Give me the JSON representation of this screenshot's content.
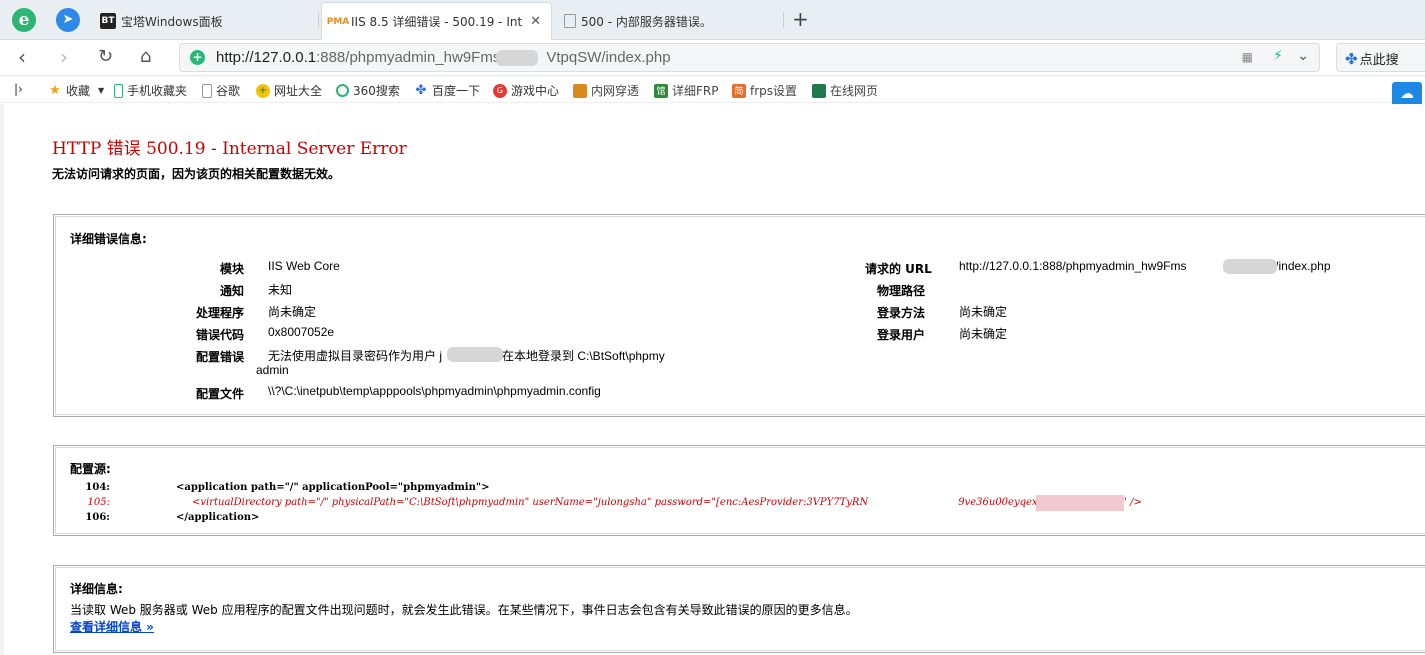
{
  "tabs": [
    {
      "label": "宝塔Windows面板",
      "favicon": "BT"
    },
    {
      "label": "IIS 8.5 详细错误 - 500.19 - Inte",
      "favicon": "PMA"
    },
    {
      "label": "500 - 内部服务器错误。",
      "favicon": ""
    }
  ],
  "address": {
    "url_prefix": "http://127.0.0.1",
    "url_suffix": ":888/phpmyadmin_hw9Fms",
    "url_tail": "VtpqSW/index.php"
  },
  "search": {
    "label": "点此搜"
  },
  "bookmarks": [
    {
      "label": "收藏",
      "icon": "star-icon"
    },
    {
      "label": "手机收藏夹",
      "icon": "phone-icon"
    },
    {
      "label": "谷歌",
      "icon": "page-icon"
    },
    {
      "label": "网址大全",
      "icon": "web-icon"
    },
    {
      "label": "360搜索",
      "icon": "360-icon"
    },
    {
      "label": "百度一下",
      "icon": "baidu-icon"
    },
    {
      "label": "游戏中心",
      "icon": "game-icon"
    },
    {
      "label": "内网穿透",
      "icon": "app-icon"
    },
    {
      "label": "详细FRP",
      "icon": "app-icon"
    },
    {
      "label": "frps设置",
      "icon": "app-icon"
    },
    {
      "label": "在线网页",
      "icon": "app-icon"
    }
  ],
  "error": {
    "title": "HTTP 错误 500.19 - Internal Server Error",
    "subtitle": "无法访问请求的页面，因为该页的相关配置数据无效。",
    "detail_heading": "详细错误信息:",
    "details_left": [
      {
        "label": "模块",
        "value": "IIS Web Core"
      },
      {
        "label": "通知",
        "value": "未知"
      },
      {
        "label": "处理程序",
        "value": "尚未确定"
      },
      {
        "label": "错误代码",
        "value": "0x8007052e"
      },
      {
        "label": "配置错误",
        "value": "无法使用虚拟目录密码作为用户 j",
        "value_tail": "在本地登录到 C:\\BtSoft\\phpmy",
        "value_line2": "admin"
      },
      {
        "label": "配置文件",
        "value": "\\\\?\\C:\\inetpub\\temp\\apppools\\phpmyadmin\\phpmyadmin.config"
      }
    ],
    "details_right": [
      {
        "label": "请求的 URL",
        "value": "http://127.0.0.1:888/phpmyadmin_hw9Fms",
        "value_tail": "pqSW/index.php"
      },
      {
        "label": "物理路径",
        "value": ""
      },
      {
        "label": "登录方法",
        "value": "尚未确定"
      },
      {
        "label": "登录用户",
        "value": "尚未确定"
      }
    ],
    "config_heading": "配置源:",
    "config_lines": [
      {
        "num": "104:",
        "code": "<application path=\"/\" applicationPool=\"phpmyadmin\">"
      },
      {
        "num": "105:",
        "code": "<virtualDirectory path=\"/\" physicalPath=\"C:\\BtSoft\\phpmyadmin\" userName=\"julongsha\" password=\"[enc:AesProvider:3VPY7TyRN",
        "code_tail": "9ve36u00eyqexf1ZBe31Q=:enc]\" />"
      },
      {
        "num": "106:",
        "code": "</application>"
      }
    ],
    "info_heading": "详细信息:",
    "info_text": "当读取 Web 服务器或 Web 应用程序的配置文件出现问题时，就会发生此错误。在某些情况下，事件日志会包含有关导致此错误的原因的更多信息。",
    "info_link": "查看详细信息 »"
  },
  "colors": {
    "error_red": "#cc0000",
    "link_blue": "#0645c8",
    "accent_green": "#2bb673"
  }
}
